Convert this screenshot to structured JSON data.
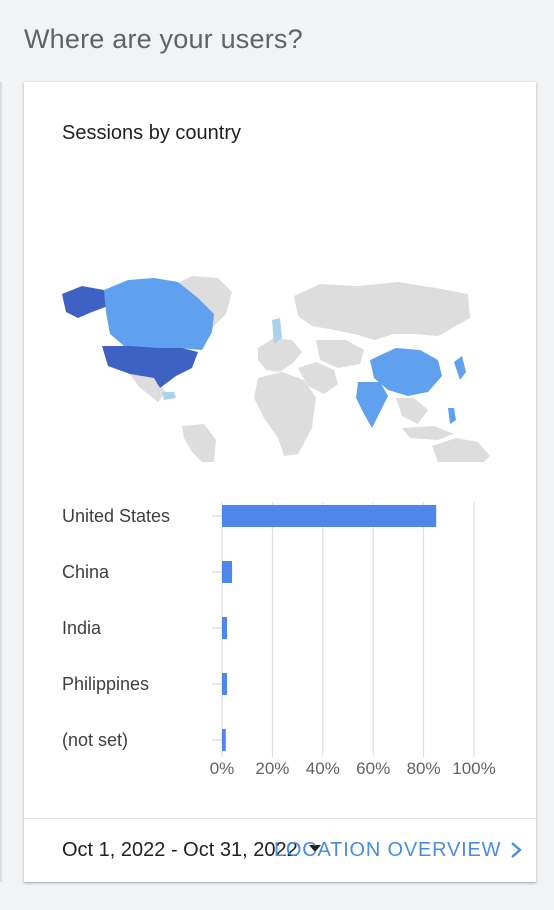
{
  "page": {
    "title": "Where are your users?"
  },
  "card": {
    "title": "Sessions by country",
    "footer": {
      "date_range": "Oct 1, 2022 - Oct 31, 2022",
      "link_label": "LOCATION OVERVIEW",
      "icons": {
        "dropdown": "caret-down-icon",
        "chevron": "chevron-right-icon"
      }
    }
  },
  "map": {
    "colors": {
      "high": "#3d62c4",
      "mid": "#5fa0ef",
      "low": "#aad3ea",
      "none": "#dddddd"
    }
  },
  "chart_data": {
    "type": "bar",
    "orientation": "horizontal",
    "categories": [
      "United States",
      "China",
      "India",
      "Philippines",
      "(not set)"
    ],
    "values": [
      85,
      4,
      2,
      2,
      1.5
    ],
    "x_ticks": [
      "0%",
      "20%",
      "40%",
      "60%",
      "80%",
      "100%"
    ],
    "xlim": [
      0,
      100
    ],
    "grid": true,
    "bar_color": "#4e86ea",
    "title": "",
    "xlabel": "",
    "ylabel": ""
  }
}
